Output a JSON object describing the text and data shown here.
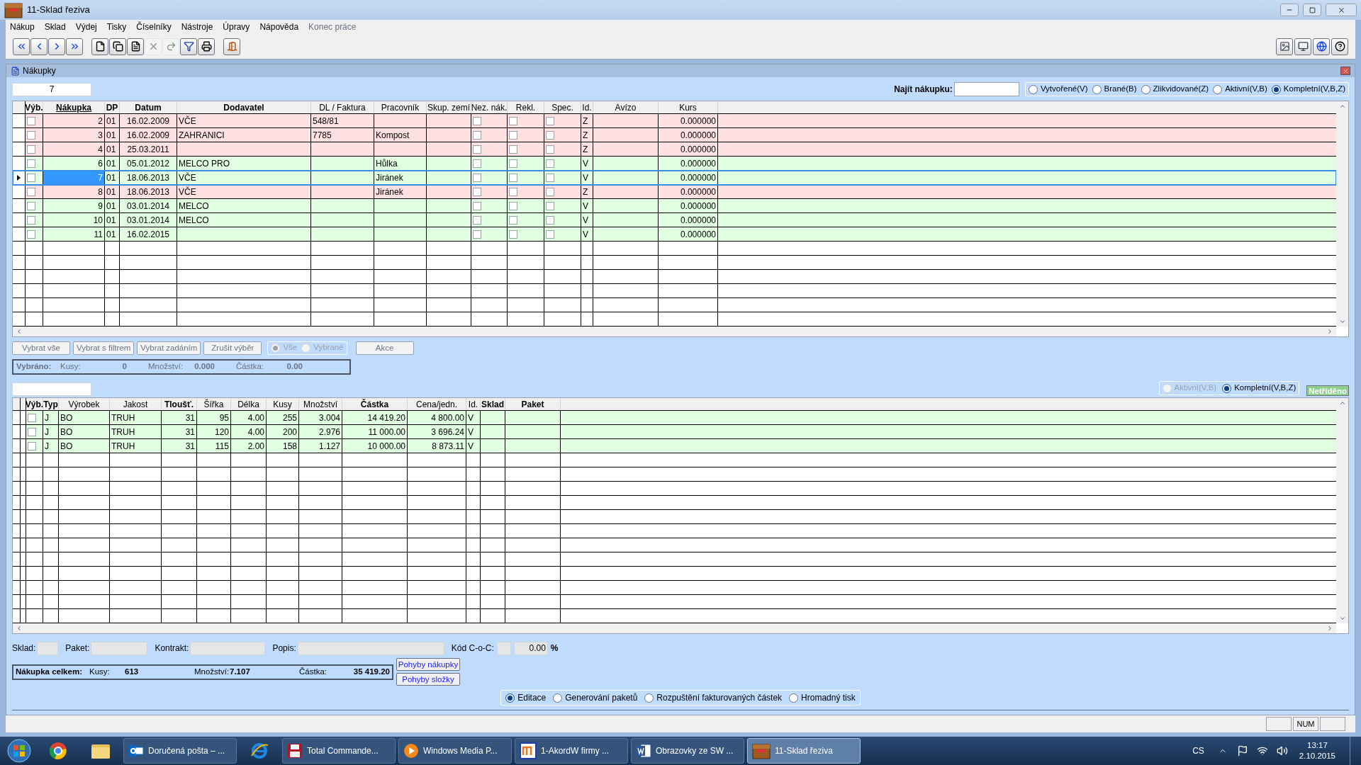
{
  "window": {
    "title": "11-Sklad řeziva"
  },
  "menu": [
    {
      "label": "Nákup",
      "disabled": false
    },
    {
      "label": "Sklad",
      "disabled": false
    },
    {
      "label": "Výdej",
      "disabled": false
    },
    {
      "label": "Tisky",
      "disabled": false
    },
    {
      "label": "Číselníky",
      "disabled": false
    },
    {
      "label": "Nástroje",
      "disabled": false
    },
    {
      "label": "Úpravy",
      "disabled": false
    },
    {
      "label": "Nápověda",
      "disabled": false
    },
    {
      "label": "Konec práce",
      "disabled": true
    }
  ],
  "toolbar": {
    "groups": [
      [
        {
          "kind": "first",
          "disabled": false
        },
        {
          "kind": "prev",
          "disabled": false
        },
        {
          "kind": "next",
          "disabled": false
        },
        {
          "kind": "last",
          "disabled": false
        }
      ],
      [
        {
          "kind": "new",
          "disabled": false
        },
        {
          "kind": "copy",
          "disabled": false
        },
        {
          "kind": "document",
          "disabled": false
        },
        {
          "kind": "delete",
          "disabled": true
        },
        {
          "kind": "redo",
          "disabled": true
        },
        {
          "kind": "filter",
          "disabled": false
        },
        {
          "kind": "print",
          "disabled": false
        }
      ],
      [
        {
          "kind": "exit",
          "disabled": false
        }
      ]
    ],
    "right": [
      {
        "kind": "image",
        "disabled": false
      },
      {
        "kind": "monitor",
        "disabled": false
      },
      {
        "kind": "globe",
        "disabled": false
      },
      {
        "kind": "help",
        "disabled": false
      }
    ]
  },
  "panel": {
    "title": "Nákupky",
    "search_value": "7",
    "find_label": "Najít nákupku:",
    "filter": [
      {
        "label": "Vytvořené(V)",
        "selected": false
      },
      {
        "label": "Brané(B)",
        "selected": false
      },
      {
        "label": "Zlikvidované(Z)",
        "selected": false
      },
      {
        "label": "Aktivní(V,B)",
        "selected": false
      },
      {
        "label": "Kompletní(V,B,Z)",
        "selected": true
      }
    ]
  },
  "purchases": {
    "columns": [
      "Výb.",
      "Nákupka",
      "DP",
      "Datum",
      "Dodavatel",
      "DL / Faktura",
      "Pracovník",
      "Skup. zemí",
      "Nez. nák.",
      "Rekl.",
      "Spec.",
      "Id.",
      "Avízo",
      "Kurs"
    ],
    "rows": [
      {
        "selected": false,
        "color": "#ffe1e1",
        "vyb": false,
        "nakupka": "2",
        "dp": "01",
        "datum": "16.02.2009",
        "dodavatel": "VČE",
        "dl": "548/81",
        "nez": false,
        "rekl": false,
        "spec": false,
        "id": "Z",
        "kurs": "0.000000"
      },
      {
        "selected": false,
        "color": "#ffe1e1",
        "vyb": false,
        "nakupka": "3",
        "dp": "01",
        "datum": "16.02.2009",
        "dodavatel": "ZAHRANICI",
        "dl": "7785",
        "pracovnik": "Kompost",
        "nez": false,
        "rekl": false,
        "spec": false,
        "id": "Z",
        "kurs": "0.000000"
      },
      {
        "selected": false,
        "color": "#ffe1e1",
        "vyb": false,
        "nakupka": "4",
        "dp": "01",
        "datum": "25.03.2011",
        "nez": false,
        "rekl": false,
        "spec": false,
        "id": "Z",
        "kurs": "0.000000"
      },
      {
        "selected": false,
        "color": "#e1ffe1",
        "vyb": false,
        "nakupka": "6",
        "dp": "01",
        "datum": "05.01.2012",
        "dodavatel": "MELCO PRO",
        "pracovnik": "Hůlka",
        "nez": false,
        "rekl": false,
        "spec": false,
        "id": "V",
        "kurs": "0.000000"
      },
      {
        "selected": true,
        "color": "#e1ffe1",
        "vyb": false,
        "nakupka": "7",
        "dp": "01",
        "datum": "18.06.2013",
        "dodavatel": "VČE",
        "pracovnik": "Jiránek",
        "nez": false,
        "rekl": false,
        "spec": false,
        "id": "V",
        "kurs": "0.000000"
      },
      {
        "selected": false,
        "color": "#ffe1e1",
        "vyb": false,
        "nakupka": "8",
        "dp": "01",
        "datum": "18.06.2013",
        "dodavatel": "VČE",
        "pracovnik": "Jiránek",
        "nez": false,
        "rekl": false,
        "spec": false,
        "id": "Z",
        "kurs": "0.000000"
      },
      {
        "selected": false,
        "color": "#e1ffe1",
        "vyb": false,
        "nakupka": "9",
        "dp": "01",
        "datum": "03.01.2014",
        "dodavatel": "MELCO",
        "nez": false,
        "rekl": false,
        "spec": false,
        "id": "V",
        "kurs": "0.000000"
      },
      {
        "selected": false,
        "color": "#e1ffe1",
        "vyb": false,
        "nakupka": "10",
        "dp": "01",
        "datum": "03.01.2014",
        "dodavatel": "MELCO",
        "nez": false,
        "rekl": false,
        "spec": false,
        "id": "V",
        "kurs": "0.000000"
      },
      {
        "selected": false,
        "color": "#e1ffe1",
        "vyb": false,
        "nakupka": "11",
        "dp": "01",
        "datum": "16.02.2015",
        "nez": false,
        "rekl": false,
        "spec": false,
        "id": "V",
        "kurs": "0.000000"
      }
    ]
  },
  "selection": {
    "buttons": [
      {
        "label": "Vybrat vše",
        "disabled": true
      },
      {
        "label": "Vybrat s filtrem",
        "disabled": true
      },
      {
        "label": "Vybrat zadáním",
        "disabled": true
      },
      {
        "label": "Zrušit výběr",
        "disabled": true
      }
    ],
    "scope": [
      {
        "label": "Vše",
        "selected": true
      },
      {
        "label": "Vybrané",
        "selected": false
      }
    ],
    "scope_disabled": true,
    "action": {
      "label": "Akce",
      "disabled": true
    },
    "summary": {
      "disabled": true,
      "title": "Vybráno:",
      "items": [
        {
          "label": "Kusy:",
          "value": "0"
        },
        {
          "label": "Množství:",
          "value": "0.000"
        },
        {
          "label": "Částka:",
          "value": "0.00"
        }
      ]
    }
  },
  "items_filter": [
    {
      "label": "Aktivní(V,B)",
      "selected": false,
      "disabled": true
    },
    {
      "label": "Kompletní(V,B,Z)",
      "selected": true,
      "disabled": false
    }
  ],
  "sort_badge": "Netříděno",
  "items": {
    "columns": [
      "Výb.",
      "Typ",
      "Výrobek",
      "Jakost",
      "Tloušť.",
      "Šířka",
      "Délka",
      "Kusy",
      "Množství",
      "Částka",
      "Cena/jedn.",
      "Id.",
      "Sklad",
      "Paket"
    ],
    "rows": [
      {
        "color": "#e1ffe1",
        "vyb": false,
        "typ": "J",
        "vyrobek": "BO",
        "jakost": "TRUH",
        "tloust": "31",
        "sirka": "95",
        "delka": "4.00",
        "kusy": "255",
        "mnozstvi": "3.004",
        "castka": "14 419.20",
        "cena": "4 800.00",
        "id": "V"
      },
      {
        "color": "#e1ffe1",
        "vyb": false,
        "typ": "J",
        "vyrobek": "BO",
        "jakost": "TRUH",
        "tloust": "31",
        "sirka": "120",
        "delka": "4.00",
        "kusy": "200",
        "mnozstvi": "2.976",
        "castka": "11 000.00",
        "cena": "3 696.24",
        "id": "V"
      },
      {
        "color": "#e1ffe1",
        "vyb": false,
        "typ": "J",
        "vyrobek": "BO",
        "jakost": "TRUH",
        "tloust": "31",
        "sirka": "115",
        "delka": "2.00",
        "kusy": "158",
        "mnozstvi": "1.127",
        "castka": "10 000.00",
        "cena": "8 873.11",
        "id": "V"
      }
    ]
  },
  "detail": {
    "fields": [
      {
        "label": "Sklad:"
      },
      {
        "label": "Paket:"
      },
      {
        "label": "Kontrakt:"
      },
      {
        "label": "Popis:"
      }
    ],
    "coc_label": "Kód C-o-C:",
    "coc_value": "0.00",
    "percent": "%"
  },
  "totals": {
    "title": "Nákupka celkem:",
    "items": [
      {
        "label": "Kusy:",
        "value": "613"
      },
      {
        "label": "Množství:",
        "value": "7.107"
      },
      {
        "label": "Částka:",
        "value": "35 419.20"
      }
    ]
  },
  "history_buttons": [
    "Pohyby nákupky",
    "Pohyby složky"
  ],
  "modes": [
    {
      "label": "Editace",
      "selected": true
    },
    {
      "label": "Generování paketů",
      "selected": false
    },
    {
      "label": "Rozpuštění fakturovaných částek",
      "selected": false
    },
    {
      "label": "Hromadný tisk",
      "selected": false
    }
  ],
  "status_bar": {
    "panes": [
      "NUM"
    ]
  },
  "taskbar": {
    "items": [
      {
        "kind": "pinned"
      },
      {
        "kind": "pinned"
      },
      {
        "kind": "task",
        "label": "Doručená pošta – ...",
        "selected": false
      },
      {
        "kind": "pinned"
      },
      {
        "kind": "task",
        "label": "Total Commande...",
        "selected": false
      },
      {
        "kind": "task",
        "label": "Windows Media P...",
        "selected": false
      },
      {
        "kind": "task",
        "label": "1-AkordW firmy ...",
        "selected": false
      },
      {
        "kind": "task",
        "label": "Obrazovky ze SW ...",
        "selected": false
      },
      {
        "kind": "task",
        "label": "11-Sklad řeziva",
        "selected": true
      }
    ],
    "language": "CS",
    "time": "13:17",
    "date": "2.10.2015"
  }
}
